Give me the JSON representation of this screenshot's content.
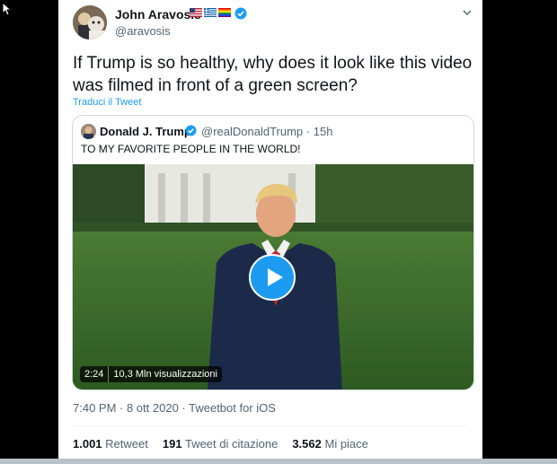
{
  "tweet": {
    "author": {
      "name": "John Aravosis",
      "handle": "@aravosis",
      "flags": [
        "us-flag-icon",
        "greece-flag-icon",
        "rainbow-flag-icon"
      ]
    },
    "text": "If Trump is so healthy, why does it look like this video was filmed in front of a green screen?",
    "translate_label": "Traduci il Tweet",
    "quoted": {
      "name": "Donald J. Trump",
      "handle": "@realDonaldTrump",
      "separator": "·",
      "time_ago": "15h",
      "text": "TO MY FAVORITE PEOPLE IN THE WORLD!",
      "video": {
        "duration": "2:24",
        "views": "10,3 Mln visualizzazioni"
      }
    },
    "timestamp": "7:40 PM · 8 ott 2020 ·",
    "source": "Tweetbot for iOS",
    "stats": {
      "retweets_count": "1.001",
      "retweets_label": "Retweet",
      "quotes_count": "191",
      "quotes_label": "Tweet di citazione",
      "likes_count": "3.562",
      "likes_label": "Mi piace"
    }
  },
  "colors": {
    "accent": "#1d9bf0",
    "muted_text": "#536471",
    "text": "#0f1419",
    "background_frame": "#000000"
  }
}
